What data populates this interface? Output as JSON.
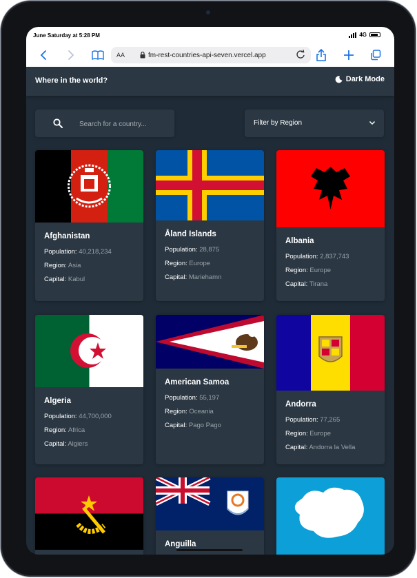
{
  "status_bar": {
    "time": "June Saturday at 5:28 PM",
    "network": "4G"
  },
  "browser": {
    "text_size": "AA",
    "url": "fm-rest-countries-api-seven.vercel.app"
  },
  "app": {
    "title": "Where in the world?",
    "mode_toggle": "Dark Mode",
    "search_placeholder": "Search for a country...",
    "filter_label": "Filter by Region"
  },
  "labels": {
    "population": "Population:",
    "region": "Region:",
    "capital": "Capital:"
  },
  "colors": {
    "background": "#1f2b36",
    "element": "#2b3844"
  },
  "countries": [
    {
      "name": "Afghanistan",
      "population": "40,218,234",
      "region": "Asia",
      "capital": "Kabul"
    },
    {
      "name": "Åland Islands",
      "population": "28,875",
      "region": "Europe",
      "capital": "Mariehamn"
    },
    {
      "name": "Albania",
      "population": "2,837,743",
      "region": "Europe",
      "capital": "Tirana"
    },
    {
      "name": "Algeria",
      "population": "44,700,000",
      "region": "Africa",
      "capital": "Algiers"
    },
    {
      "name": "American Samoa",
      "population": "55,197",
      "region": "Oceania",
      "capital": "Pago Pago"
    },
    {
      "name": "Andorra",
      "population": "77,265",
      "region": "Europe",
      "capital": "Andorra la Vella"
    },
    {
      "name": "Anguilla"
    }
  ]
}
